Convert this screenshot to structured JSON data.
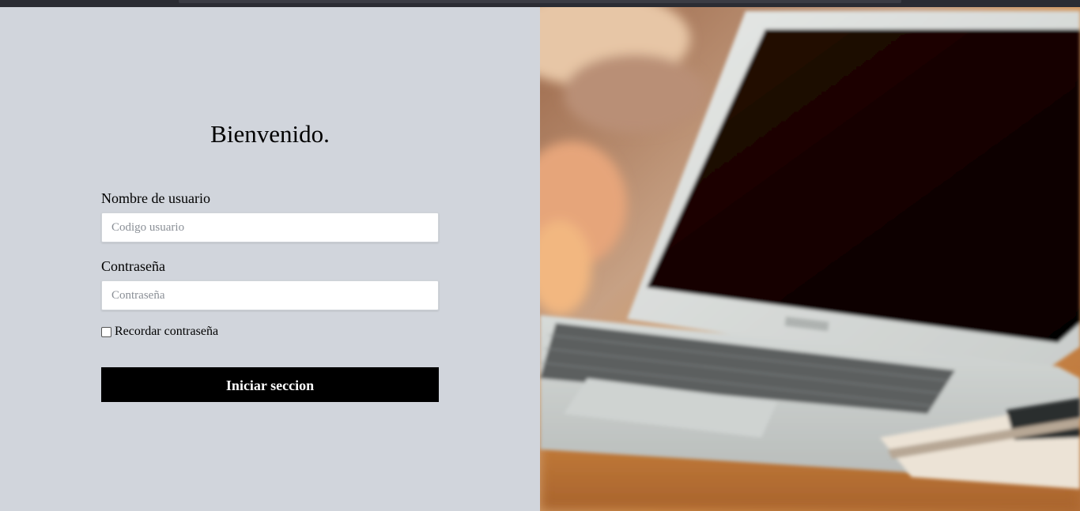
{
  "login": {
    "title": "Bienvenido.",
    "username_label": "Nombre de usuario",
    "username_placeholder": "Codigo usuario",
    "password_label": "Contraseña",
    "password_placeholder": "Contraseña",
    "remember_label": "Recordar contraseña",
    "submit_label": "Iniciar seccion"
  },
  "colors": {
    "panel_background": "#d1d5dc",
    "button_background": "#000000",
    "button_text": "#ffffff"
  },
  "hero_image": {
    "subject": "laptop-on-desk-photo"
  }
}
